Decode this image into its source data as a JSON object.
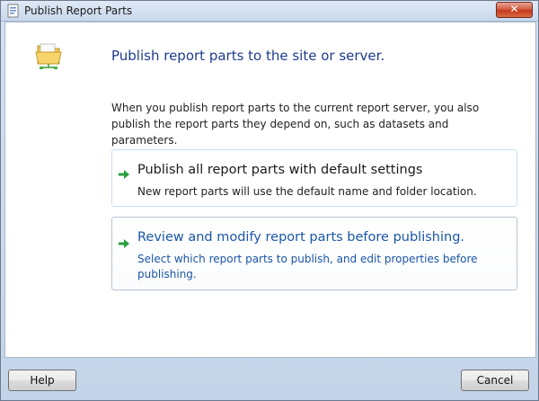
{
  "window": {
    "title": "Publish Report Parts"
  },
  "content": {
    "heading": "Publish report parts to the site or server.",
    "intro": "When you publish report parts to the current report server, you also publish the report parts they depend on, such as datasets and parameters."
  },
  "options": [
    {
      "title": "Publish all report parts with default settings",
      "description": "New report parts will use the default name and folder location."
    },
    {
      "title": "Review and modify report parts before publishing.",
      "description": "Select which report parts to publish, and edit properties before publishing."
    }
  ],
  "buttons": {
    "help": "Help",
    "cancel": "Cancel"
  },
  "colors": {
    "heading": "#1e3c8c",
    "link": "#1a56a8",
    "arrow": "#2aa043"
  },
  "icons": {
    "app": "report-app-icon",
    "folder": "server-folder-icon",
    "arrow": "green-arrow-icon",
    "close": "close-icon"
  }
}
